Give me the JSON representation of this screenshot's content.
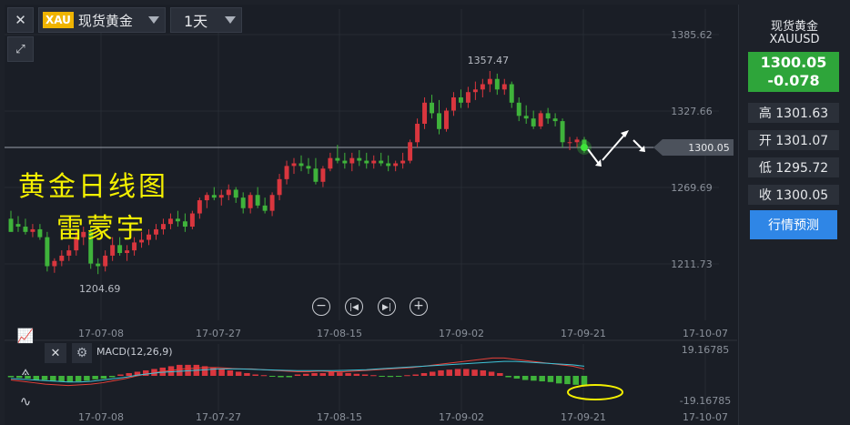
{
  "toolbar": {
    "close_icon": "close-icon",
    "expand_icon": "expand-icon",
    "symbol_badge": "XAU",
    "symbol_name": "现货黄金",
    "period": "1天"
  },
  "side_panel": {
    "name": "现货黄金",
    "code": "XAUUSD",
    "price": "1300.05",
    "change": "-0.078",
    "high": "高 1301.63",
    "open": "开 1301.07",
    "low": "低 1295.72",
    "close": "收 1300.05",
    "quote_button": "行情预测",
    "price_color": "#2ea53a",
    "button_color": "#2f86e6"
  },
  "annotations": {
    "line1": "黄金日线图",
    "line2": "雷蒙宇"
  },
  "macd_label": "MACD(12,26,9)",
  "zoom_controls": [
    "zoom-out-icon",
    "step-back-icon",
    "step-forward-icon",
    "zoom-in-icon"
  ],
  "chart_data": [
    {
      "type": "candlestick",
      "price_axis_labels": [
        "1385.62",
        "1327.66",
        "1269.69",
        "1211.73"
      ],
      "ylim": [
        1180,
        1395
      ],
      "x_tick_labels": [
        "17-07-08",
        "17-07-27",
        "17-08-15",
        "17-09-02",
        "17-09-21",
        "17-10-07"
      ],
      "current_price_label": "1300.05",
      "current_price": 1300.05,
      "annotation_high": "1357.47",
      "annotation_low": "1204.69",
      "colors": {
        "up": "#d9363e",
        "down": "#3fb33b"
      },
      "candles": [
        [
          1246,
          1252,
          1238,
          1236
        ],
        [
          1242,
          1248,
          1236,
          1240
        ],
        [
          1240,
          1246,
          1234,
          1236
        ],
        [
          1236,
          1242,
          1232,
          1238
        ],
        [
          1238,
          1242,
          1230,
          1232
        ],
        [
          1232,
          1236,
          1206,
          1210
        ],
        [
          1210,
          1216,
          1205,
          1214
        ],
        [
          1214,
          1222,
          1210,
          1218
        ],
        [
          1218,
          1226,
          1214,
          1222
        ],
        [
          1222,
          1236,
          1218,
          1232
        ],
        [
          1232,
          1240,
          1226,
          1236
        ],
        [
          1236,
          1240,
          1208,
          1212
        ],
        [
          1212,
          1216,
          1204,
          1210
        ],
        [
          1210,
          1222,
          1206,
          1218
        ],
        [
          1218,
          1232,
          1214,
          1226
        ],
        [
          1226,
          1232,
          1218,
          1220
        ],
        [
          1220,
          1226,
          1214,
          1222
        ],
        [
          1222,
          1232,
          1218,
          1228
        ],
        [
          1228,
          1236,
          1224,
          1230
        ],
        [
          1230,
          1238,
          1226,
          1234
        ],
        [
          1234,
          1242,
          1230,
          1238
        ],
        [
          1238,
          1246,
          1234,
          1242
        ],
        [
          1242,
          1250,
          1238,
          1246
        ],
        [
          1246,
          1252,
          1240,
          1244
        ],
        [
          1244,
          1250,
          1236,
          1240
        ],
        [
          1240,
          1252,
          1238,
          1250
        ],
        [
          1250,
          1262,
          1246,
          1260
        ],
        [
          1260,
          1266,
          1254,
          1264
        ],
        [
          1264,
          1270,
          1260,
          1262
        ],
        [
          1262,
          1268,
          1256,
          1264
        ],
        [
          1264,
          1272,
          1260,
          1268
        ],
        [
          1268,
          1270,
          1258,
          1262
        ],
        [
          1262,
          1266,
          1250,
          1254
        ],
        [
          1254,
          1266,
          1250,
          1264
        ],
        [
          1264,
          1270,
          1254,
          1256
        ],
        [
          1256,
          1262,
          1250,
          1252
        ],
        [
          1252,
          1266,
          1248,
          1264
        ],
        [
          1264,
          1280,
          1260,
          1276
        ],
        [
          1276,
          1290,
          1272,
          1286
        ],
        [
          1286,
          1292,
          1280,
          1288
        ],
        [
          1288,
          1294,
          1282,
          1286
        ],
        [
          1286,
          1292,
          1280,
          1284
        ],
        [
          1284,
          1292,
          1272,
          1274
        ],
        [
          1274,
          1286,
          1270,
          1284
        ],
        [
          1284,
          1296,
          1282,
          1292
        ],
        [
          1292,
          1302,
          1288,
          1290
        ],
        [
          1290,
          1296,
          1284,
          1288
        ],
        [
          1288,
          1296,
          1282,
          1292
        ],
        [
          1292,
          1298,
          1286,
          1290
        ],
        [
          1290,
          1296,
          1284,
          1288
        ],
        [
          1288,
          1294,
          1284,
          1290
        ],
        [
          1290,
          1296,
          1286,
          1288
        ],
        [
          1288,
          1294,
          1282,
          1286
        ],
        [
          1286,
          1290,
          1282,
          1288
        ],
        [
          1288,
          1296,
          1284,
          1290
        ],
        [
          1290,
          1306,
          1288,
          1304
        ],
        [
          1304,
          1322,
          1300,
          1318
        ],
        [
          1318,
          1338,
          1314,
          1334
        ],
        [
          1334,
          1340,
          1322,
          1326
        ],
        [
          1326,
          1336,
          1310,
          1314
        ],
        [
          1314,
          1330,
          1312,
          1328
        ],
        [
          1328,
          1342,
          1324,
          1338
        ],
        [
          1338,
          1344,
          1330,
          1334
        ],
        [
          1334,
          1346,
          1330,
          1342
        ],
        [
          1342,
          1350,
          1336,
          1344
        ],
        [
          1344,
          1352,
          1338,
          1348
        ],
        [
          1348,
          1358,
          1342,
          1352
        ],
        [
          1352,
          1356,
          1340,
          1344
        ],
        [
          1344,
          1352,
          1340,
          1348
        ],
        [
          1348,
          1350,
          1330,
          1334
        ],
        [
          1334,
          1338,
          1320,
          1324
        ],
        [
          1324,
          1332,
          1318,
          1322
        ],
        [
          1322,
          1328,
          1314,
          1316
        ],
        [
          1316,
          1328,
          1314,
          1326
        ],
        [
          1326,
          1330,
          1318,
          1322
        ],
        [
          1322,
          1326,
          1316,
          1320
        ],
        [
          1320,
          1322,
          1300,
          1304
        ],
        [
          1304,
          1308,
          1298,
          1304
        ],
        [
          1304,
          1308,
          1300,
          1306
        ],
        [
          1306,
          1308,
          1296,
          1300
        ]
      ]
    },
    {
      "type": "macd",
      "axis_labels": [
        "19.16785",
        "-19.16785"
      ],
      "ylim": [
        -19.16785,
        19.16785
      ],
      "x_tick_labels": [
        "17-07-08",
        "17-07-27",
        "17-08-15",
        "17-09-02",
        "17-09-21",
        "17-10-07"
      ],
      "histogram": [
        -1,
        -1.5,
        -2,
        -3,
        -3,
        -4,
        -4,
        -4.5,
        -4,
        -3.5,
        -2.5,
        -2,
        -1,
        1,
        2,
        3,
        4,
        5,
        6,
        7,
        8,
        8,
        8,
        7,
        6,
        5,
        4,
        3,
        2,
        1,
        0.5,
        -0.5,
        -1,
        -1,
        1,
        1.5,
        2,
        2,
        3,
        2.5,
        2,
        1.5,
        1,
        0.5,
        -0.5,
        -0.8,
        -0.5,
        0.5,
        1,
        2,
        3,
        4,
        4.5,
        5,
        5,
        4.5,
        4,
        3,
        2,
        -1,
        -2,
        -3,
        -3.5,
        -4,
        -4.5,
        -5.5,
        -6,
        -6.5,
        -7
      ],
      "macd_line": [
        -3,
        -4,
        -5,
        -6,
        -6.5,
        -7,
        -6.5,
        -6,
        -5,
        -3.5,
        -2,
        0,
        1.5,
        3,
        4,
        5,
        5.5,
        6,
        6,
        5.5,
        5,
        5,
        4.5,
        4,
        3.5,
        3,
        3,
        3.5,
        3,
        3,
        3.5,
        4,
        4.5,
        5,
        5.5,
        6,
        7,
        8,
        9,
        10,
        11,
        12,
        13,
        13,
        12,
        11,
        10,
        9,
        8,
        7,
        5
      ],
      "signal_line": [
        -2,
        -2.5,
        -3,
        -3.5,
        -4,
        -4.5,
        -4.5,
        -4,
        -3,
        -2,
        -1,
        0.5,
        1.5,
        2.5,
        3,
        3.5,
        4,
        4.5,
        5,
        5,
        5,
        4.8,
        4.5,
        4.2,
        4,
        3.8,
        3.8,
        3.8,
        3.8,
        4,
        4.2,
        4.5,
        5,
        5.5,
        6,
        6.5,
        7,
        7.5,
        8,
        8.5,
        9,
        9.5,
        10,
        10.5,
        10.5,
        10,
        9.5,
        9,
        8.5,
        8,
        7
      ]
    }
  ]
}
